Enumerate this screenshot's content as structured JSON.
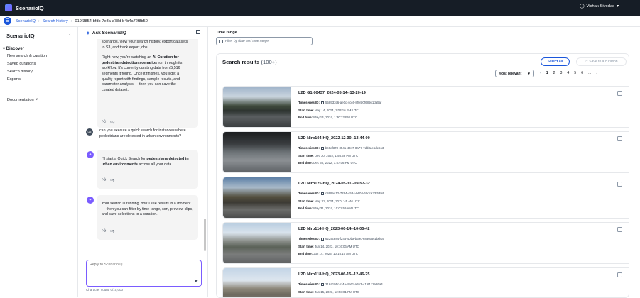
{
  "app": {
    "title": "ScenarioIQ",
    "user": "Vishak Sivodas"
  },
  "breadcrumb": {
    "items": [
      "ScenarioIQ",
      "Search history"
    ],
    "current": "019f3854-bfdb-7e3a-a78d-b4b4a72f8b50"
  },
  "sidebar": {
    "title": "ScenarioIQ",
    "section": "Discover",
    "items": [
      "New search & curation",
      "Saved curations",
      "Search history",
      "Exports"
    ],
    "documentation": "Documentation"
  },
  "chat": {
    "title": "Ask ScenarioIQ",
    "messages": {
      "m1": {
        "t1": "scenarios, view your search history, export datasets",
        "t2": "to S3, and track export jobs.",
        "t3": "Right now, you're watching an ",
        "b1": "AI Curation for",
        "b2": "pedestrian detection scenarios",
        "t4": " run through its",
        "t5": "workflow. It's currently curating data from 5,516",
        "t6": "segments it found. Once it finishes, you'll get a",
        "t7": "quality report with findings, sample results, and",
        "t8": "parameter analysis — then you can save the",
        "t9": "curated dataset."
      },
      "user_initials": "VS",
      "user_msg": "can you execute a quick search for instances where pedestrians are detected in urban environments?",
      "m2": {
        "t1": "I'll start a Quick Search for ",
        "b1": "pedestrians detected in urban environments",
        "t2": " across all your data."
      },
      "m3": "Your search is running. You'll see results in a moment — then you can filter by time range, sort, preview clips, and save selections to a curation."
    },
    "input_placeholder": "Reply to ScenarioIQ",
    "char_count": "Character count: 0/10,000"
  },
  "filters": {
    "time_range_label": "Time range",
    "time_range_placeholder": "Filter by date and time range"
  },
  "results": {
    "title": "Search results",
    "count": "(100+)",
    "select_all": "Select all",
    "save_to_curation": "Save to a curation",
    "sort": "Most relevant",
    "pages": [
      "1",
      "2",
      "3",
      "4",
      "5",
      "6",
      "..."
    ],
    "labels": {
      "ts": "Timeseries ID:",
      "start": "Start time:",
      "end": "End time:"
    },
    "items": [
      {
        "name": "L2D G1-00437_2024-05-14--13-20-19",
        "id": "558933c6-ae0c-4cc6-8f04-0f68661da5af",
        "start": "May 14, 2024, 1:03:16 PM UTC",
        "end": "May 14, 2024, 1:30:22 PM UTC"
      },
      {
        "name": "L2D Niro104-HQ_2022-12-30--13-44-00",
        "id": "bc0ef373-354a-4347-8a77-7dd3ae5de513",
        "start": "Dec 30, 2022, 1:56:58 PM UTC",
        "end": "Dec 30, 2022, 1:57:06 PM UTC"
      },
      {
        "name": "L2D Niro125-HQ_2024-05-31--09-57-32",
        "id": "c869ad12-7294-4534-b604-60dca33f539d",
        "start": "May 31, 2024, 10:01:45 AM UTC",
        "end": "May 31, 2024, 10:01:59 AM UTC"
      },
      {
        "name": "L2D Niro114-HQ_2023-06-14--10-05-42",
        "id": "6224ce84-f245-40ba-b39c-6836c5c1bd4a",
        "start": "Jun 14, 2023, 10:16:06 AM UTC",
        "end": "Jun 14, 2023, 10:16:10 AM UTC"
      },
      {
        "name": "L2D Niro118-HQ_2023-06-15--12-46-25",
        "id": "316a195c-cf4a-4b61-a653-41f61c2a26a4",
        "start": "Jun 15, 2023, 12:58:01 PM UTC",
        "end": ""
      }
    ]
  },
  "colors": {
    "accent": "#1a56db",
    "topbar": "#161d26",
    "bot": "#7a5cff"
  }
}
